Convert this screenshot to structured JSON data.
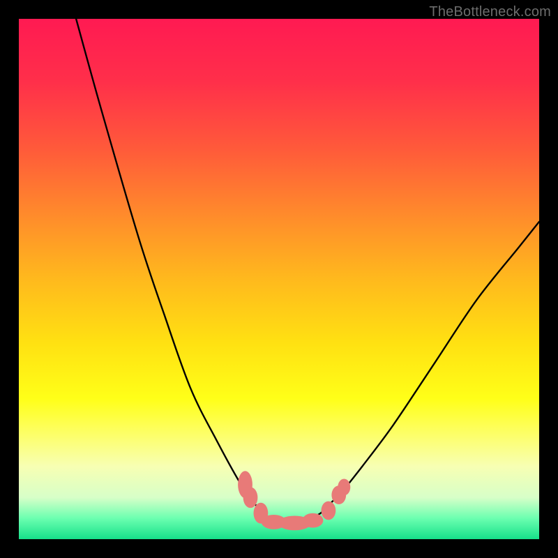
{
  "watermark": "TheBottleneck.com",
  "chart_data": {
    "type": "line",
    "title": "",
    "xlabel": "",
    "ylabel": "",
    "xlim": [
      0,
      100
    ],
    "ylim": [
      0,
      100
    ],
    "series": [
      {
        "name": "bottleneck-curve",
        "x": [
          11,
          16,
          23,
          28,
          33,
          38,
          43,
          46,
          48,
          50,
          52,
          54,
          56,
          58,
          60,
          62,
          66,
          72,
          80,
          88,
          96,
          100
        ],
        "values": [
          100,
          82,
          58,
          43,
          29,
          19,
          10,
          6,
          4,
          3,
          3,
          3,
          4,
          5,
          7,
          9,
          14,
          22,
          34,
          46,
          56,
          61
        ]
      }
    ],
    "markers": {
      "name": "highlight-dots",
      "color": "#e87a78",
      "points": [
        {
          "x": 43.5,
          "y": 10.5,
          "rx": 1.4,
          "ry": 2.6
        },
        {
          "x": 44.5,
          "y": 8.0,
          "rx": 1.4,
          "ry": 2.0
        },
        {
          "x": 46.5,
          "y": 5.0,
          "rx": 1.4,
          "ry": 2.0
        },
        {
          "x": 49.0,
          "y": 3.3,
          "rx": 2.4,
          "ry": 1.4
        },
        {
          "x": 53.0,
          "y": 3.1,
          "rx": 3.2,
          "ry": 1.4
        },
        {
          "x": 56.5,
          "y": 3.6,
          "rx": 2.0,
          "ry": 1.4
        },
        {
          "x": 59.5,
          "y": 5.5,
          "rx": 1.4,
          "ry": 1.8
        },
        {
          "x": 61.5,
          "y": 8.5,
          "rx": 1.4,
          "ry": 1.8
        },
        {
          "x": 62.5,
          "y": 10.0,
          "rx": 1.2,
          "ry": 1.6
        }
      ]
    }
  }
}
